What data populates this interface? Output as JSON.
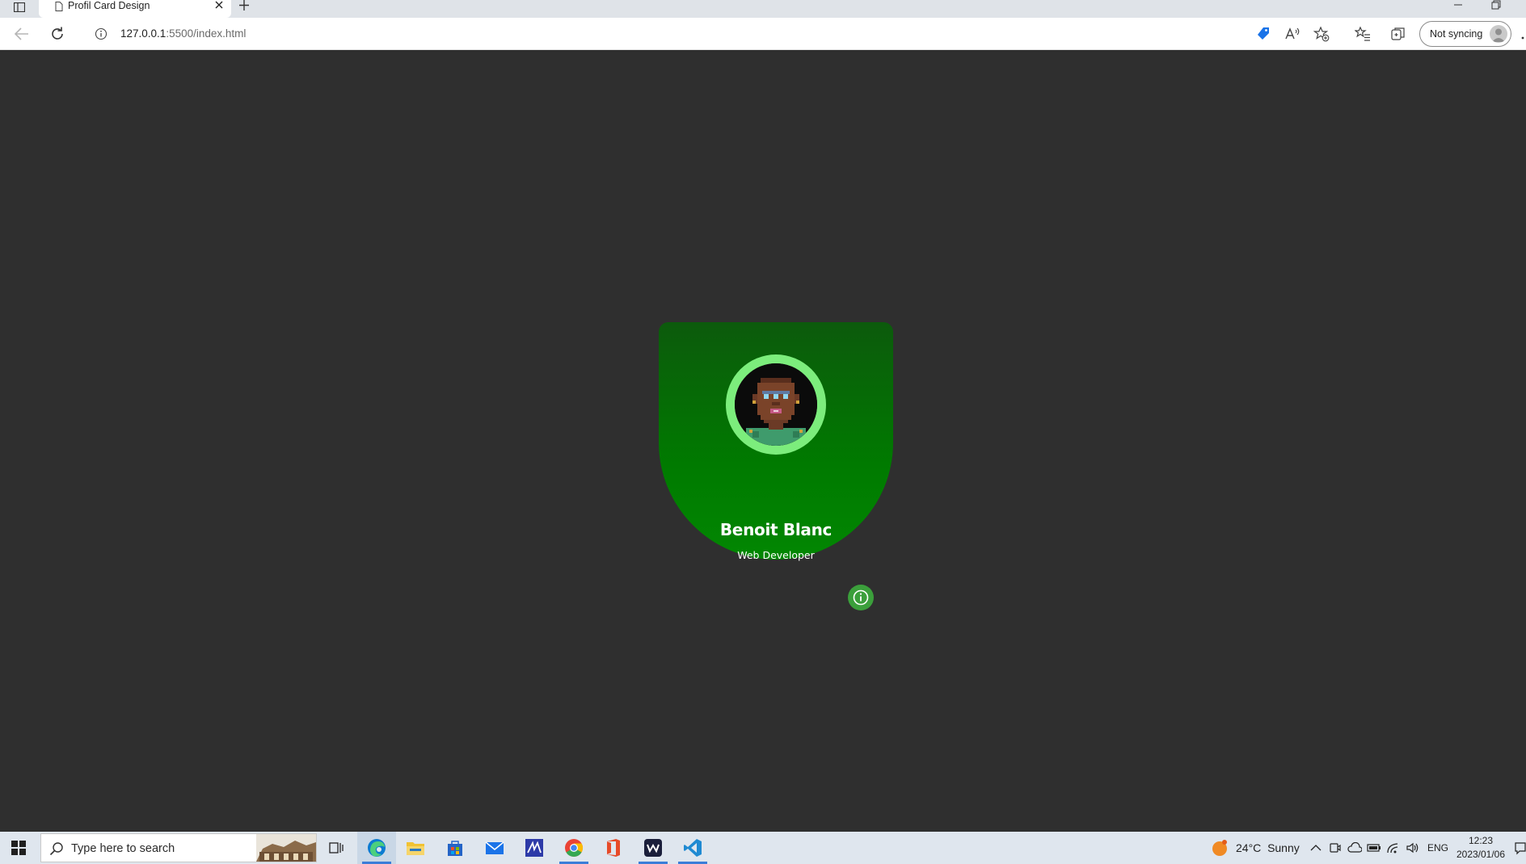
{
  "browser": {
    "tab": {
      "title": "Profil Card Design"
    },
    "address": {
      "host": "127.0.0.1",
      "rest": ":5500/index.html"
    },
    "profile": {
      "sync_label": "Not syncing"
    }
  },
  "card": {
    "name": "Benoit Blanc",
    "role": "Web Developer",
    "colors": {
      "top": "#0c5a0c",
      "bottom": "#028702",
      "ring": "#7ced7c",
      "page_bg": "#2f2f2f",
      "info_button": "#3b9f3b"
    }
  },
  "taskbar": {
    "search_placeholder": "Type here to search",
    "apps": [
      "task-view",
      "edge",
      "file-explorer",
      "microsoft-store",
      "mail",
      "app-blue",
      "chrome",
      "office",
      "app-dark",
      "vscode"
    ],
    "weather": {
      "temp": "24°C",
      "condition": "Sunny"
    },
    "language": "ENG",
    "time": "12:23",
    "date": "2023/01/06"
  }
}
